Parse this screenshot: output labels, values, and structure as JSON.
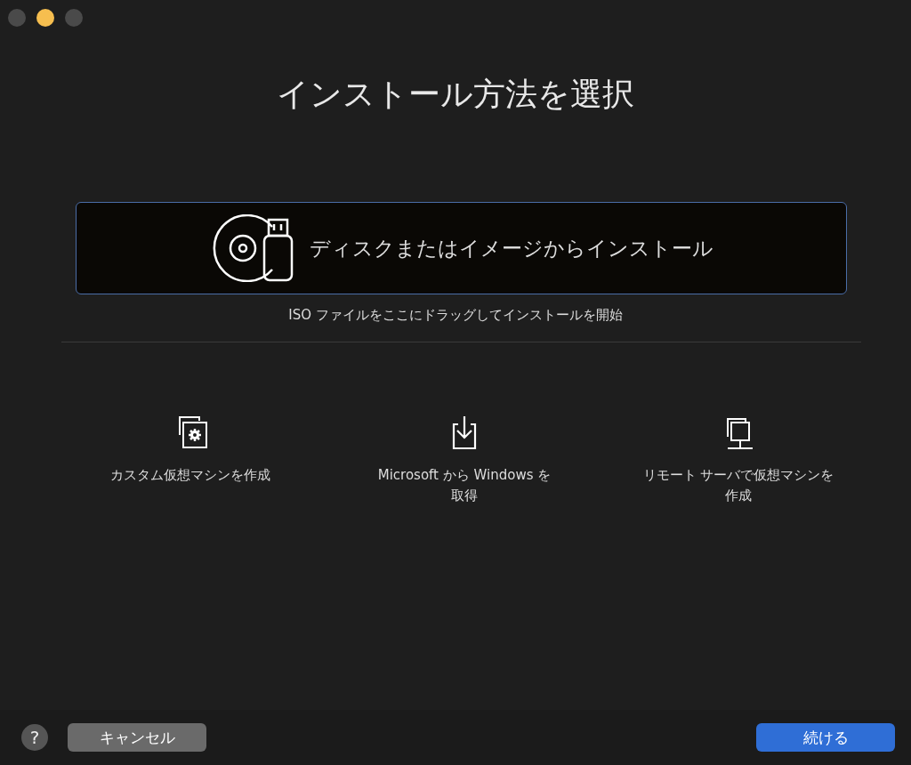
{
  "window": {
    "controls": [
      {
        "color": "#4a4a4a"
      },
      {
        "color": "#f6be4f"
      },
      {
        "color": "#4a4a4a"
      }
    ],
    "title": "インストール方法を選択"
  },
  "primary_option": {
    "label": "ディスクまたはイメージからインストール",
    "selected": true
  },
  "hint": "ISO ファイルをここにドラッグしてインストールを開始",
  "options": [
    {
      "kind": "custom",
      "label": "カスタム仮想マシンを作成",
      "selected": false
    },
    {
      "kind": "download",
      "label": "Microsoft から Windows を取得",
      "selected": false
    },
    {
      "kind": "remote",
      "label": "リモート サーバで仮想マシンを作成",
      "selected": false
    }
  ],
  "footer": {
    "help": "?",
    "buttons": [
      {
        "kind": "secondary",
        "label": "キャンセル"
      },
      {
        "kind": "primary",
        "label": "続ける"
      }
    ]
  }
}
